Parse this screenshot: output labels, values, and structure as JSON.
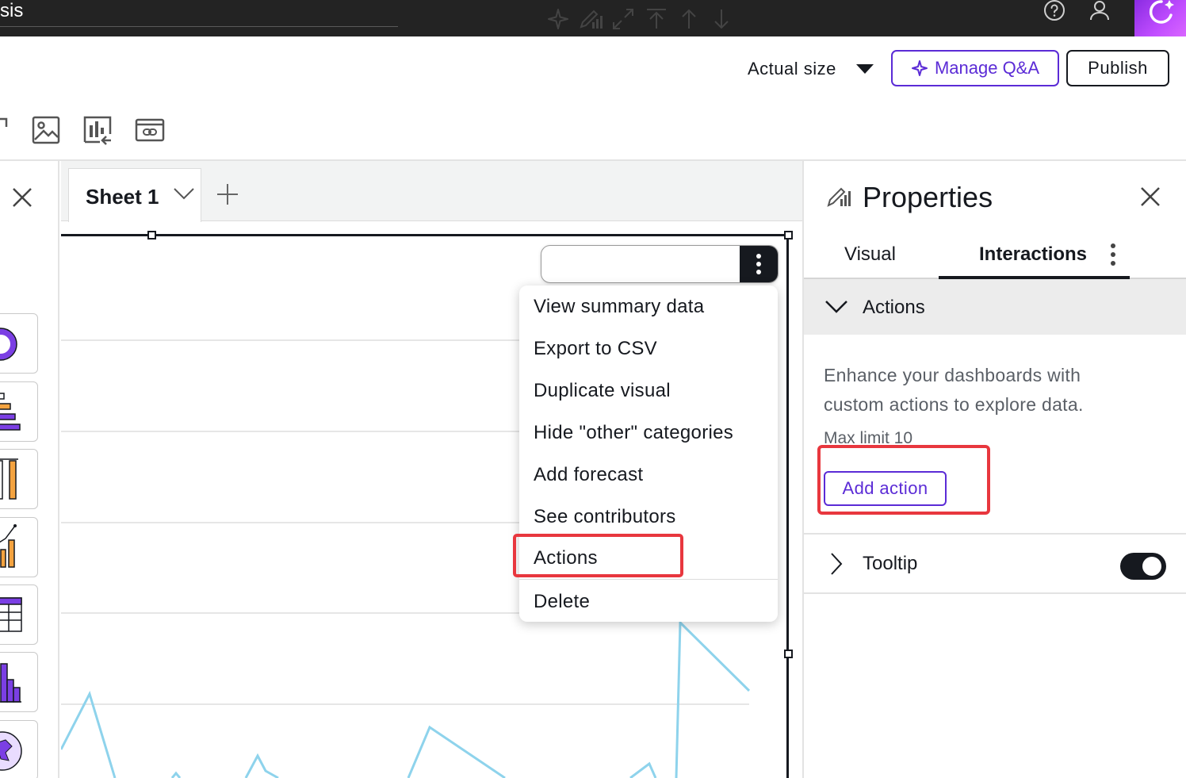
{
  "topbar": {
    "title_fragment": "sis",
    "help_icon": "help-circle-icon",
    "user_icon": "user-icon",
    "q_icon": "amazon-q-icon",
    "q_gradient": [
      "#8a2be2",
      "#d966ff"
    ]
  },
  "header": {
    "size_label": "Actual size",
    "manage_qa_label": "Manage Q&A",
    "publish_label": "Publish",
    "accent_color": "#5b2bd6"
  },
  "toolbar": {
    "items": [
      "image-icon",
      "insert-visual-icon",
      "embed-icon"
    ]
  },
  "sheet": {
    "tab_label": "Sheet 1",
    "add_icon": "plus-icon"
  },
  "visual_toolbar": {
    "icons": [
      "sparkle-icon",
      "format-visual-icon",
      "expand-icon",
      "bring-to-front-icon",
      "move-up-icon",
      "move-down-icon",
      "more-vertical-icon"
    ]
  },
  "menu": {
    "items": [
      "View summary data",
      "Export to CSV",
      "Duplicate visual",
      "Hide \"other\" categories",
      "Add forecast",
      "See contributors",
      "Actions",
      "Delete"
    ],
    "highlighted": "Actions"
  },
  "properties": {
    "title": "Properties",
    "tabs": [
      "Visual",
      "Interactions"
    ],
    "active_tab": "Interactions",
    "actions_section": {
      "label": "Actions",
      "desc_line1": "Enhance your dashboards with",
      "desc_line2": "custom actions to explore data.",
      "max_limit": "Max limit 10",
      "add_button": "Add action"
    },
    "tooltip_section": {
      "label": "Tooltip",
      "enabled": true
    }
  },
  "highlight_color": "#e8373e"
}
